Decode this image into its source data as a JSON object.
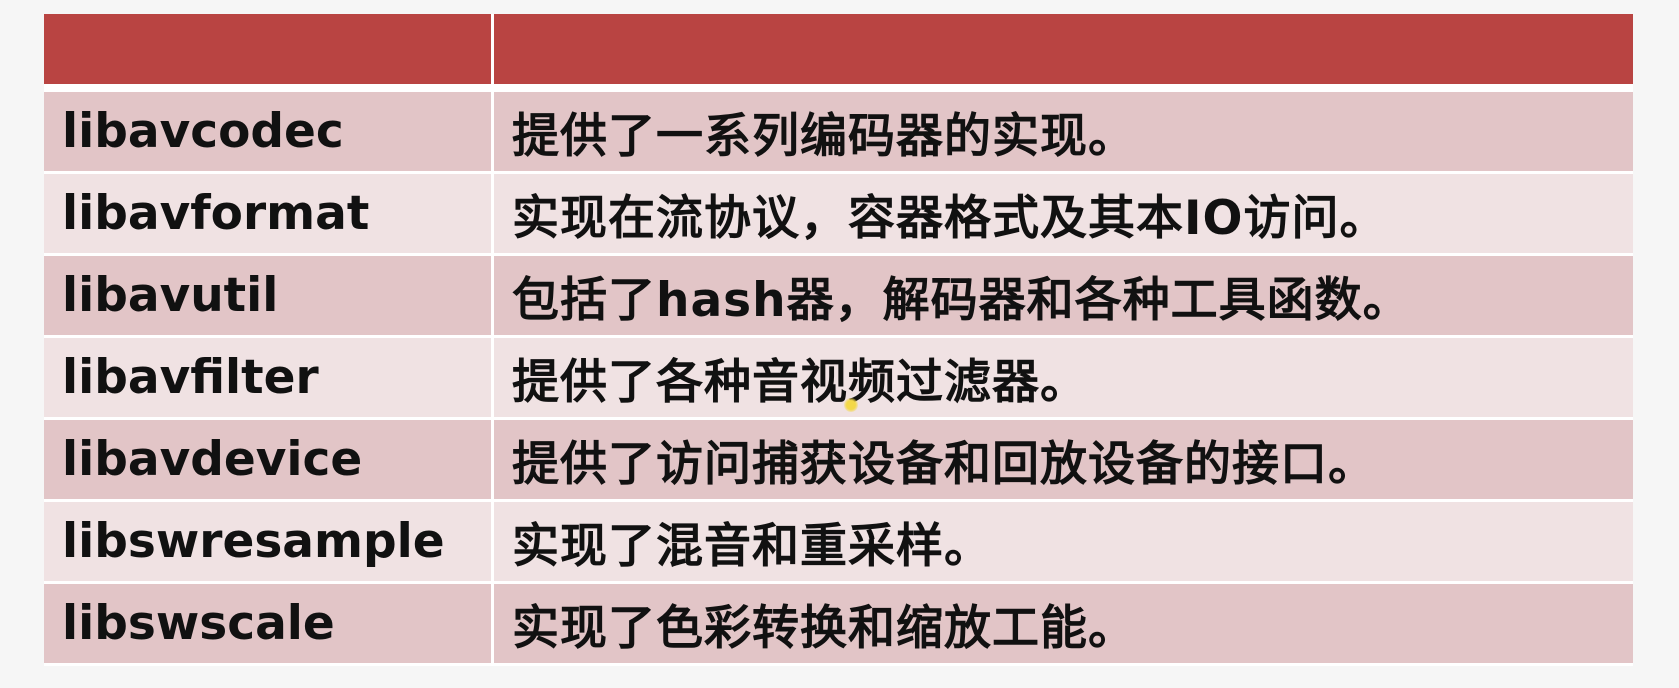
{
  "header": {
    "col1": "",
    "col2": ""
  },
  "rows": [
    {
      "name": "libavcodec",
      "desc": "提供了一系列编码器的实现。"
    },
    {
      "name": "libavformat",
      "desc": "实现在流协议，容器格式及其本IO访问。"
    },
    {
      "name": "libavutil",
      "desc": "包括了hash器，解码器和各种工具函数。"
    },
    {
      "name": "libavfilter",
      "desc": "提供了各种音视频过滤器。"
    },
    {
      "name": "libavdevice",
      "desc": "提供了访问捕获设备和回放设备的接口。"
    },
    {
      "name": "libswresample",
      "desc": "实现了混音和重采样。"
    },
    {
      "name": "libswscale",
      "desc": "实现了色彩转换和缩放工能。"
    }
  ],
  "colors": {
    "header": "#b94442",
    "row_odd": "#e2c5c7",
    "row_even": "#f0e2e3"
  }
}
